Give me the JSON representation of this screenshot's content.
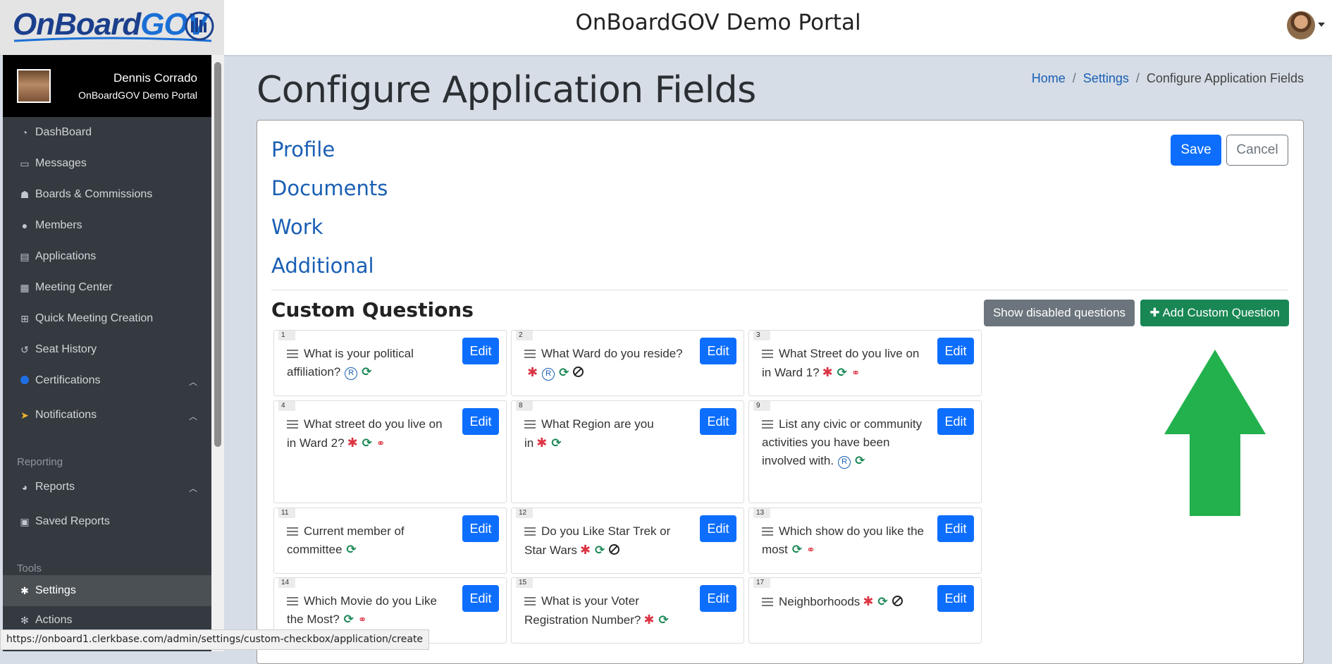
{
  "header": {
    "logo_on": "OnBoard",
    "logo_gov": "GOV",
    "title": "OnBoardGOV Demo Portal"
  },
  "user": {
    "name": "Dennis Corrado",
    "org": "OnBoardGOV Demo Portal"
  },
  "sidebar": {
    "items": [
      {
        "label": "DashBoard",
        "icon": "dashboard-icon"
      },
      {
        "label": "Messages",
        "icon": "inbox-icon"
      },
      {
        "label": "Boards & Commissions",
        "icon": "users-icon"
      },
      {
        "label": "Members",
        "icon": "user-icon"
      },
      {
        "label": "Applications",
        "icon": "id-card-icon"
      },
      {
        "label": "Meeting Center",
        "icon": "calendar-icon"
      },
      {
        "label": "Quick Meeting Creation",
        "icon": "calendar-plus-icon"
      },
      {
        "label": "Seat History",
        "icon": "history-icon"
      },
      {
        "label": "Certifications",
        "icon": "circle-icon"
      },
      {
        "label": "Notifications",
        "icon": "paper-plane-icon"
      },
      {
        "label": "Reports",
        "icon": "pie-chart-icon"
      },
      {
        "label": "Saved Reports",
        "icon": "save-icon"
      },
      {
        "label": "Settings",
        "icon": "gear-icon"
      },
      {
        "label": "Actions",
        "icon": "gears-icon"
      }
    ],
    "header_reporting": "Reporting",
    "header_tools": "Tools"
  },
  "page": {
    "title": "Configure Application Fields",
    "breadcrumb": {
      "home": "Home",
      "settings": "Settings",
      "current": "Configure Application Fields",
      "sep": "/"
    }
  },
  "sections": {
    "profile": "Profile",
    "documents": "Documents",
    "work": "Work",
    "additional": "Additional"
  },
  "buttons": {
    "save": "Save",
    "cancel": "Cancel",
    "show_disabled": "Show disabled questions",
    "add_custom": "Add Custom Question",
    "edit": "Edit"
  },
  "custom_questions": {
    "title": "Custom Questions",
    "items": [
      {
        "num": "1",
        "text": "What is your political affiliation?"
      },
      {
        "num": "2",
        "text": "What Ward do you reside?"
      },
      {
        "num": "3",
        "text": "What Street do you live on in Ward 1?"
      },
      {
        "num": "4",
        "text": "What street do you live on in Ward 2?"
      },
      {
        "num": "8",
        "text": "What Region are you in"
      },
      {
        "num": "9",
        "text": "List any civic or community activities you have been involved with."
      },
      {
        "num": "11",
        "text": "Current member of committee"
      },
      {
        "num": "12",
        "text": "Do you Like Star Trek or Star Wars"
      },
      {
        "num": "13",
        "text": "Which show do you like the most"
      },
      {
        "num": "14",
        "text": "Which Movie do you Like the Most?"
      },
      {
        "num": "15",
        "text": "What is your Voter Registration Number?"
      },
      {
        "num": "17",
        "text": "Neighborhoods"
      }
    ]
  },
  "statusbar": {
    "url": "https://onboard1.clerkbase.com/admin/settings/custom-checkbox/application/create"
  },
  "colors": {
    "primary": "#0d6efd",
    "success": "#198754",
    "secondary": "#6c757d",
    "danger": "#dc3545",
    "sidebar": "#343a40",
    "arrow": "#22b14c"
  }
}
